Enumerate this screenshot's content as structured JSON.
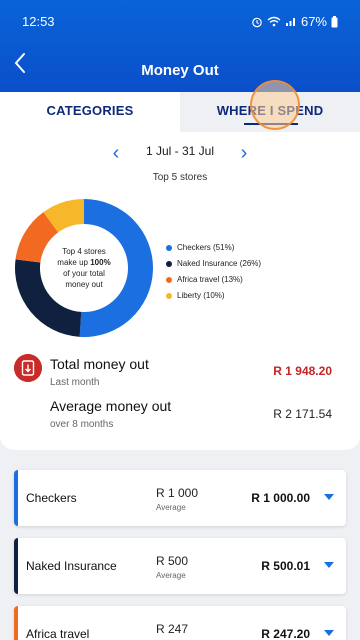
{
  "status_bar": {
    "time": "12:53",
    "battery": "67%"
  },
  "header": {
    "title": "Money Out"
  },
  "tabs": [
    {
      "label": "CATEGORIES",
      "selected": false
    },
    {
      "label": "WHERE I SPEND",
      "selected": true
    }
  ],
  "date_range": "1 Jul - 31 Jul",
  "subtitle": "Top 5 stores",
  "donut_center": {
    "line1": "Top 4 stores",
    "line2": "make up",
    "highlight": "100%",
    "line3": "of your total",
    "line4": "money out"
  },
  "chart_data": {
    "type": "pie",
    "categories": [
      "Checkers",
      "Naked Insurance",
      "Africa travel",
      "Liberty"
    ],
    "values": [
      51,
      26,
      13,
      10
    ],
    "colors": [
      "#1b6fe0",
      "#10213f",
      "#f26a21",
      "#f6b72a"
    ]
  },
  "legend": [
    {
      "label": "Checkers (51%)",
      "color": "#1b6fe0"
    },
    {
      "label": "Naked Insurance (26%)",
      "color": "#10213f"
    },
    {
      "label": "Africa travel (13%)",
      "color": "#f26a21"
    },
    {
      "label": "Liberty (10%)",
      "color": "#f6b72a"
    }
  ],
  "summary": {
    "total_label": "Total money out",
    "total_sub": "Last month",
    "total_amount": "R 1 948.20",
    "avg_label": "Average money out",
    "avg_sub": "over 8 months",
    "avg_amount": "R 2 171.54"
  },
  "stores": [
    {
      "name": "Checkers",
      "avg": "R 1 000",
      "avg_label": "Average",
      "amount": "R 1 000.00",
      "color": "#1b6fe0"
    },
    {
      "name": "Naked Insurance",
      "avg": "R 500",
      "avg_label": "Average",
      "amount": "R 500.01",
      "color": "#10213f"
    },
    {
      "name": "Africa travel",
      "avg": "R 247",
      "avg_label": "Average",
      "amount": "R 247.20",
      "color": "#f26a21"
    }
  ]
}
